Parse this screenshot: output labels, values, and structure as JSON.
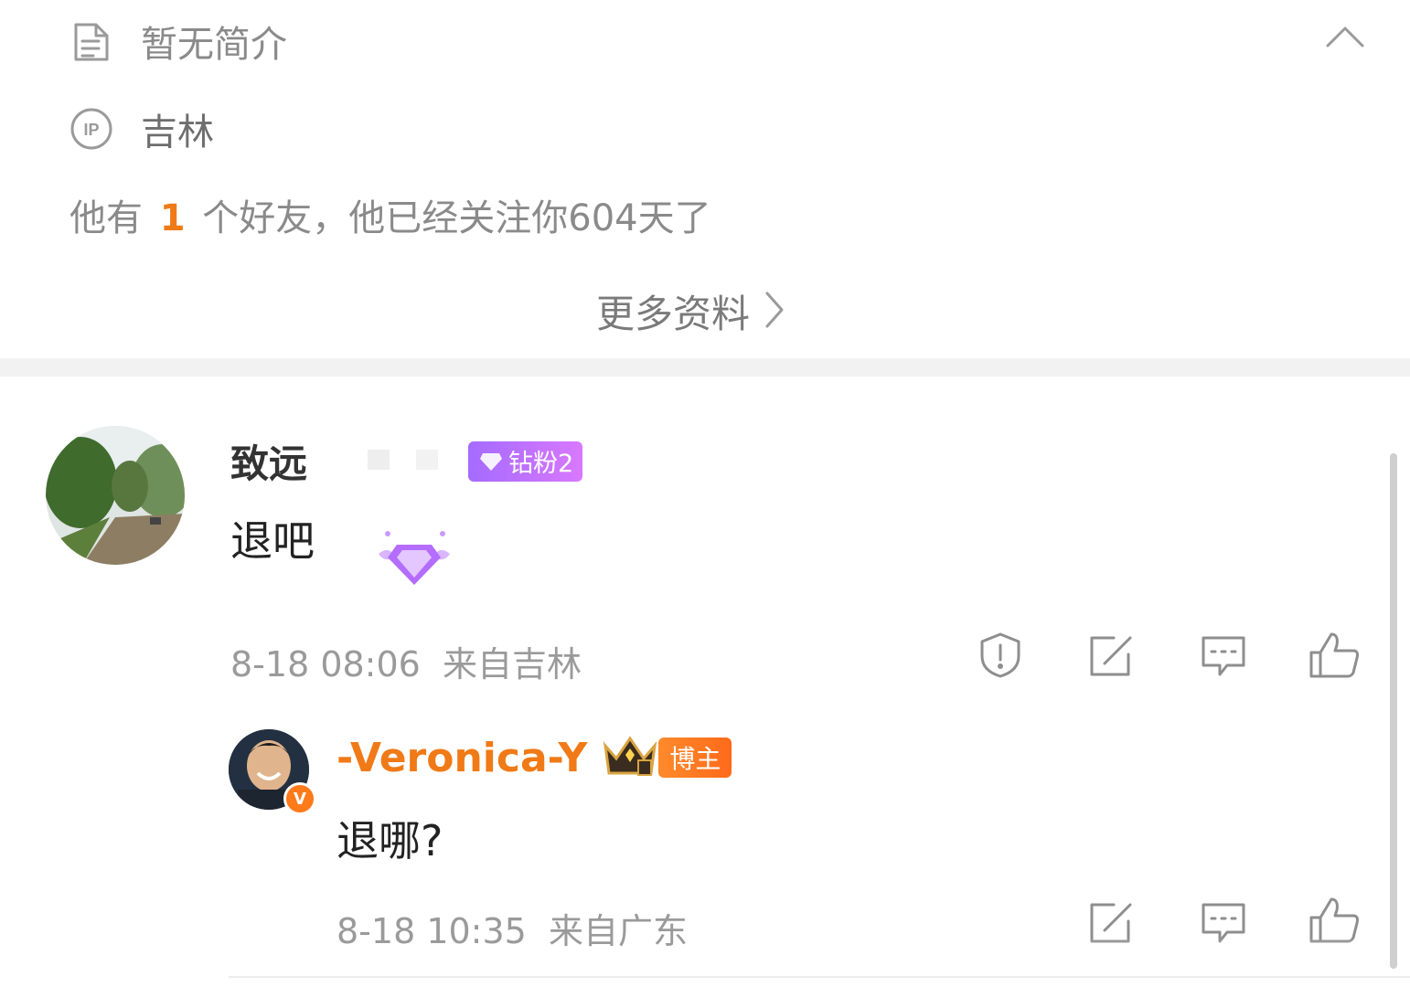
{
  "profile": {
    "bio": "暂无简介",
    "ip_location": "吉林",
    "friends_prefix": "他有",
    "friends_count": "1",
    "friends_suffix": "个好友，他已经关注你604天了",
    "more_info_label": "更多资料",
    "icons": {
      "bio": "document-icon",
      "ip": "ip-icon",
      "collapse": "chevron-up-icon",
      "more": "chevron-right-icon"
    }
  },
  "comment": {
    "username": "致远",
    "fan_badge": "钻粉2",
    "text": "退吧",
    "time": "8-18 08:06",
    "location": "来自吉林",
    "actions": [
      "report-icon",
      "share-icon",
      "comment-icon",
      "like-icon"
    ]
  },
  "reply": {
    "username": "-Veronica-Y",
    "host_badge": "博主",
    "text": "退哪?",
    "time": "8-18 10:35",
    "location": "来自广东",
    "actions": [
      "share-icon",
      "comment-icon",
      "like-icon"
    ]
  },
  "colors": {
    "accent_orange": "#f07a17",
    "badge_purple": "#b36cff",
    "muted": "#8a8a8a"
  }
}
